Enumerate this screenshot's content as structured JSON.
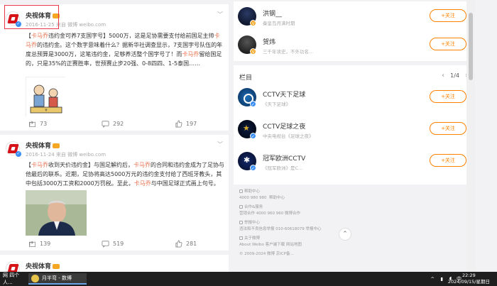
{
  "posts": [
    {
      "author": "央视体育",
      "meta": "2016-11-25 来自 微博 weibo.com",
      "text_segments": [
        {
          "t": "【",
          "hl": false
        },
        {
          "t": "卡马乔",
          "hl": true
        },
        {
          "t": "违约金可养7支国字号】5000万，这是足协需要支付给前国足主帅",
          "hl": false
        },
        {
          "t": "卡马乔",
          "hl": true
        },
        {
          "t": "的违约金。这个数字意味着什么？据新华社调查显示，7支国字号队伍的年度总预算是3000万，这笔违约金，足够养活整个国字号了！而",
          "hl": false
        },
        {
          "t": "卡马乔",
          "hl": true
        },
        {
          "t": "留给国足的，只是35%的正赛胜率，世预赛止步20强、0-8四四、1-5泰国……",
          "hl": false
        }
      ],
      "actions": {
        "share": "73",
        "comment": "292",
        "like": "197"
      }
    },
    {
      "author": "央视体育",
      "meta": "2016-11-24 来自 微博 weibo.com",
      "text_segments": [
        {
          "t": "【",
          "hl": false
        },
        {
          "t": "卡马乔",
          "hl": true
        },
        {
          "t": "收到天价违约金】与国足解约后，",
          "hl": false
        },
        {
          "t": "卡马乔",
          "hl": true
        },
        {
          "t": "的合同和违约金成为了足协与他最后的联系。近期，足协将高达5000万元的违约金支付给了西班牙教头，其中包括3000万工资和2000万罚税。至此，",
          "hl": false
        },
        {
          "t": "卡马乔",
          "hl": true
        },
        {
          "t": "与中国足球正式画上句号。",
          "hl": false
        }
      ],
      "actions": {
        "share": "139",
        "comment": "519",
        "like": "281"
      }
    },
    {
      "author": "央视体育"
    }
  ],
  "recommend": [
    {
      "name": "洪钢__",
      "sub": "秦皇岛月满时期",
      "follow": "+关注"
    },
    {
      "name": "贺炜",
      "sub": "三千年读史，不外功名...",
      "follow": "+关注"
    }
  ],
  "lanmu": {
    "title": "栏目",
    "page": "1/4",
    "items": [
      {
        "name": "CCTV天下足球",
        "sub": "《天下足球》",
        "follow": "+关注"
      },
      {
        "name": "CCTV足球之夜",
        "sub": "中央电视台《足球之夜》",
        "follow": "+关注"
      },
      {
        "name": "冠军欧洲CCTV",
        "sub": "《冠军欧洲》是C...",
        "follow": "+关注"
      }
    ]
  },
  "footer": {
    "help_title": "帮助中心",
    "help_phone": "4000 980 980",
    "help_link": "帮助中心",
    "coop_title": "合作&服务",
    "coop_line": "营销合作 4000 960 960  微博合作",
    "report_title": "举报中心",
    "report_line": "违法和不良信息举报 010-60618079  举报中心",
    "about_title": "关于微博",
    "about_line": "About Weibo   客户端下载   网站地图",
    "copyright": "© 2009-2024 微博 京ICP备..."
  },
  "taskbar": {
    "item1": "网 四个人...",
    "item2": "月半弯 - 数博",
    "tray_text": "中",
    "time": "22:29",
    "date": "2024/09/15/星期日"
  }
}
